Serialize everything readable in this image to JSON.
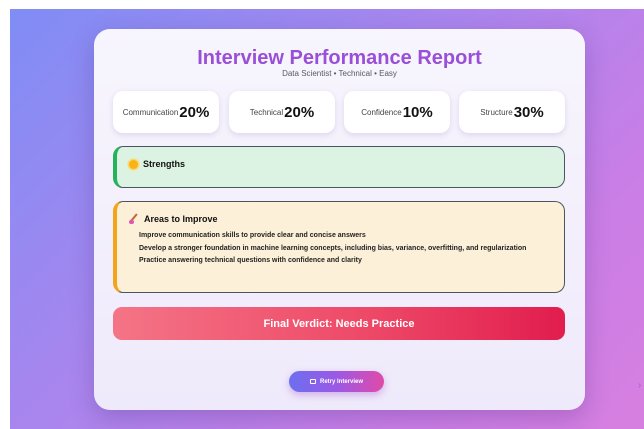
{
  "report": {
    "title": "Interview Performance Report",
    "subtitle": "Data Scientist • Technical • Easy"
  },
  "stats": [
    {
      "label": "Communication",
      "value": "20%"
    },
    {
      "label": "Technical",
      "value": "20%"
    },
    {
      "label": "Confidence",
      "value": "10%"
    },
    {
      "label": "Structure",
      "value": "30%"
    }
  ],
  "strengths": {
    "heading": "Strengths",
    "icon": "sun-icon"
  },
  "improve": {
    "heading": "Areas to Improve",
    "icon": "paintbrush-icon",
    "items": [
      "Improve communication skills to provide clear and concise answers",
      "Develop a stronger foundation in machine learning concepts, including bias, variance, overfitting, and regularization",
      "Practice answering technical questions with confidence and clarity"
    ]
  },
  "verdict": {
    "text": "Final Verdict: Needs Practice"
  },
  "retry": {
    "label": "Retry Interview",
    "icon": "retry-icon"
  },
  "colors": {
    "title": "#9a4fd8",
    "strengths_accent": "#26b25a",
    "improve_accent": "#f2a51b",
    "verdict": "#e11d4e"
  }
}
